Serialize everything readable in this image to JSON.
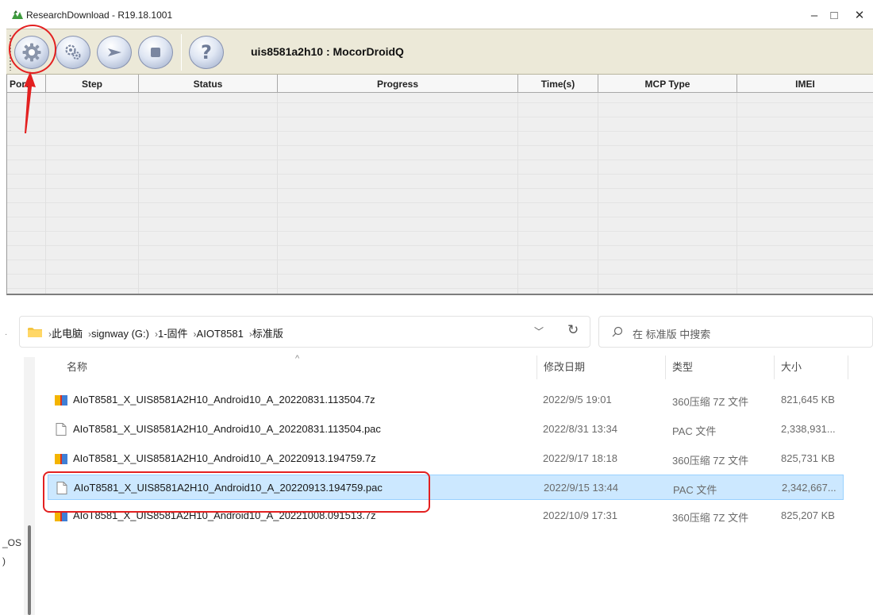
{
  "window": {
    "title": "ResearchDownload - R19.18.1001",
    "minimize": "–",
    "maximize": "□",
    "close": "✕"
  },
  "toolbar": {
    "device_label": "uis8581a2h10 : MocorDroidQ",
    "buttons": [
      {
        "name": "load-packet",
        "icon": "gear-icon"
      },
      {
        "name": "settings",
        "icon": "gears-icon"
      },
      {
        "name": "start-download",
        "icon": "play-icon"
      },
      {
        "name": "stop-download",
        "icon": "stop-icon"
      },
      {
        "name": "help",
        "icon": "question-icon",
        "glyph": "?"
      }
    ]
  },
  "grid": {
    "columns": [
      "Port",
      "Step",
      "Status",
      "Progress",
      "Time(s)",
      "MCP Type",
      "IMEI"
    ]
  },
  "explorer": {
    "breadcrumb": [
      "此电脑",
      "signway (G:)",
      "1-固件",
      "AIOT8581",
      "标准版"
    ],
    "breadcrumb_sep": "›",
    "search_placeholder": "在 标准版 中搜索",
    "headers": {
      "name": "名称",
      "date": "修改日期",
      "type": "类型",
      "size": "大小"
    },
    "files": [
      {
        "name": "AIoT8581_X_UIS8581A2H10_Android10_A_20220831.113504.7z",
        "date": "2022/9/5 19:01",
        "type": "360压缩 7Z 文件",
        "size": "821,645 KB",
        "icon": "archive-icon"
      },
      {
        "name": "AIoT8581_X_UIS8581A2H10_Android10_A_20220831.113504.pac",
        "date": "2022/8/31 13:34",
        "type": "PAC 文件",
        "size": "2,338,931...",
        "icon": "file-icon"
      },
      {
        "name": "AIoT8581_X_UIS8581A2H10_Android10_A_20220913.194759.7z",
        "date": "2022/9/17 18:18",
        "type": "360压缩 7Z 文件",
        "size": "825,731 KB",
        "icon": "archive-icon"
      },
      {
        "name": "AIoT8581_X_UIS8581A2H10_Android10_A_20220913.194759.pac",
        "date": "2022/9/15 13:44",
        "type": "PAC 文件",
        "size": "2,342,667...",
        "icon": "file-icon",
        "selected": true
      },
      {
        "name": "AIoT8581_X_UIS8581A2H10_Android10_A_20221008.091513.7z",
        "date": "2022/10/9 17:31",
        "type": "360压缩 7Z 文件",
        "size": "825,207 KB",
        "icon": "archive-icon"
      }
    ],
    "left_pane_cut": [
      "_OS",
      ")"
    ]
  },
  "annotations": {
    "color": "#e32020"
  }
}
